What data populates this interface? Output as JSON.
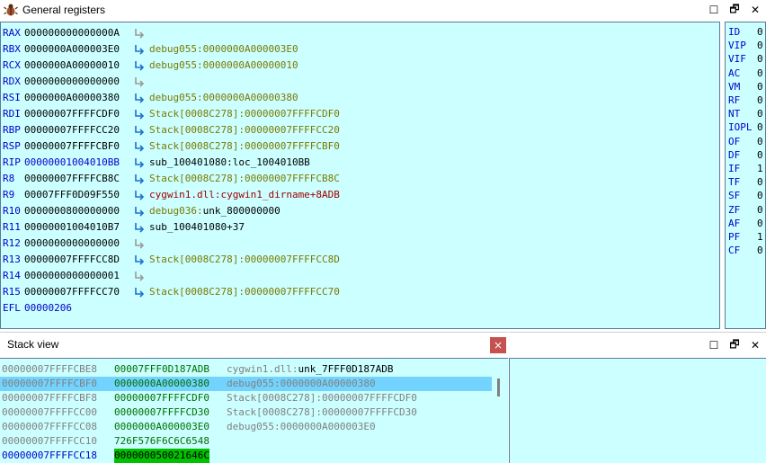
{
  "registers_window": {
    "title": "General registers",
    "registers": [
      {
        "name": "RAX",
        "value": "000000000000000A",
        "arrow": "gray",
        "ref": []
      },
      {
        "name": "RBX",
        "value": "0000000A000003E0",
        "arrow": "blue",
        "ref": [
          {
            "t": "debug055:0000000A000003E0",
            "c": "olive"
          }
        ]
      },
      {
        "name": "RCX",
        "value": "0000000A00000010",
        "arrow": "blue",
        "ref": [
          {
            "t": "debug055:0000000A00000010",
            "c": "olive"
          }
        ]
      },
      {
        "name": "RDX",
        "value": "0000000000000000",
        "arrow": "gray",
        "ref": []
      },
      {
        "name": "RSI",
        "value": "0000000A00000380",
        "arrow": "blue",
        "ref": [
          {
            "t": "debug055:0000000A00000380",
            "c": "olive"
          }
        ]
      },
      {
        "name": "RDI",
        "value": "00000007FFFFCDF0",
        "arrow": "blue",
        "ref": [
          {
            "t": "Stack[0008C278]:00000007FFFFCDF0",
            "c": "olive"
          }
        ]
      },
      {
        "name": "RBP",
        "value": "00000007FFFFCC20",
        "arrow": "blue",
        "ref": [
          {
            "t": "Stack[0008C278]:00000007FFFFCC20",
            "c": "olive"
          }
        ]
      },
      {
        "name": "RSP",
        "value": "00000007FFFFCBF0",
        "arrow": "blue",
        "ref": [
          {
            "t": "Stack[0008C278]:00000007FFFFCBF0",
            "c": "olive"
          }
        ]
      },
      {
        "name": "RIP",
        "value": "00000001004010BB",
        "value_color": "blue",
        "arrow": "blue",
        "ref": [
          {
            "t": "sub_100401080:loc_1004010BB",
            "c": "black"
          }
        ]
      },
      {
        "name": "R8",
        "value": "00000007FFFFCB8C",
        "arrow": "blue",
        "ref": [
          {
            "t": "Stack[0008C278]:00000007FFFFCB8C",
            "c": "olive"
          }
        ]
      },
      {
        "name": "R9",
        "value": "00007FFF0D09F550",
        "arrow": "blue",
        "ref": [
          {
            "t": "cygwin1.dll:cygwin1_dirname+8ADB",
            "c": "red"
          }
        ]
      },
      {
        "name": "R10",
        "value": "0000000800000000",
        "arrow": "blue",
        "ref": [
          {
            "t": "debug036:",
            "c": "olive"
          },
          {
            "t": "unk_800000000",
            "c": "black"
          }
        ]
      },
      {
        "name": "R11",
        "value": "00000001004010B7",
        "arrow": "blue",
        "ref": [
          {
            "t": "sub_100401080+37",
            "c": "black"
          }
        ]
      },
      {
        "name": "R12",
        "value": "0000000000000000",
        "arrow": "gray",
        "ref": []
      },
      {
        "name": "R13",
        "value": "00000007FFFFCC8D",
        "arrow": "blue",
        "ref": [
          {
            "t": "Stack[0008C278]:00000007FFFFCC8D",
            "c": "olive"
          }
        ]
      },
      {
        "name": "R14",
        "value": "0000000000000001",
        "arrow": "gray",
        "ref": []
      },
      {
        "name": "R15",
        "value": "00000007FFFFCC70",
        "arrow": "blue",
        "ref": [
          {
            "t": "Stack[0008C278]:00000007FFFFCC70",
            "c": "olive"
          }
        ]
      },
      {
        "name": "EFL",
        "value": "00000206",
        "value_color": "blue",
        "arrow": "none",
        "ref": []
      }
    ],
    "flags": [
      {
        "name": "ID",
        "value": "0"
      },
      {
        "name": "VIP",
        "value": "0"
      },
      {
        "name": "VIF",
        "value": "0"
      },
      {
        "name": "AC",
        "value": "0"
      },
      {
        "name": "VM",
        "value": "0"
      },
      {
        "name": "RF",
        "value": "0"
      },
      {
        "name": "NT",
        "value": "0"
      },
      {
        "name": "IOPL",
        "value": "0"
      },
      {
        "name": "OF",
        "value": "0"
      },
      {
        "name": "DF",
        "value": "0"
      },
      {
        "name": "IF",
        "value": "1"
      },
      {
        "name": "TF",
        "value": "0"
      },
      {
        "name": "SF",
        "value": "0"
      },
      {
        "name": "ZF",
        "value": "0"
      },
      {
        "name": "AF",
        "value": "0"
      },
      {
        "name": "PF",
        "value": "1"
      },
      {
        "name": "CF",
        "value": "0"
      }
    ]
  },
  "stack_view": {
    "title": "Stack view",
    "close_label": "×",
    "rows": [
      {
        "addr": "00000007FFFFCBE8",
        "value": "00007FFF0D187ADB",
        "ref": [
          {
            "t": "cygwin1.dll:",
            "c": "gray"
          },
          {
            "t": "unk_7FFF0D187ADB",
            "c": "black"
          }
        ],
        "highlight": false
      },
      {
        "addr": "00000007FFFFCBF0",
        "value": "0000000A00000380",
        "ref": [
          {
            "t": "debug055:0000000A00000380",
            "c": "gray"
          }
        ],
        "highlight": true
      },
      {
        "addr": "00000007FFFFCBF8",
        "value": "00000007FFFFCDF0",
        "ref": [
          {
            "t": "Stack[0008C278]:00000007FFFFCDF0",
            "c": "gray"
          }
        ],
        "highlight": false
      },
      {
        "addr": "00000007FFFFCC00",
        "value": "00000007FFFFCD30",
        "ref": [
          {
            "t": "Stack[0008C278]:00000007FFFFCD30",
            "c": "gray"
          }
        ],
        "highlight": false
      },
      {
        "addr": "00000007FFFFCC08",
        "value": "0000000A000003E0",
        "ref": [
          {
            "t": "debug055:0000000A000003E0",
            "c": "gray"
          }
        ],
        "highlight": false
      },
      {
        "addr": "00000007FFFFCC10",
        "value": "726F576F6C6C6548",
        "ref": [],
        "highlight": false
      },
      {
        "addr": "00000007FFFFCC18",
        "value": "000000050021646C",
        "ref": [],
        "highlight": false,
        "addr_blue": true,
        "value_hl": true
      }
    ]
  },
  "window_buttons": {
    "close": "✕",
    "restore": "🗗",
    "maximize": "☐"
  },
  "colors": {
    "panel_bg": "#ccffff",
    "register_name": "#0000cc",
    "reference_olive": "#7a7a00",
    "reference_red": "#a00000",
    "selection": "#73d3ff"
  }
}
